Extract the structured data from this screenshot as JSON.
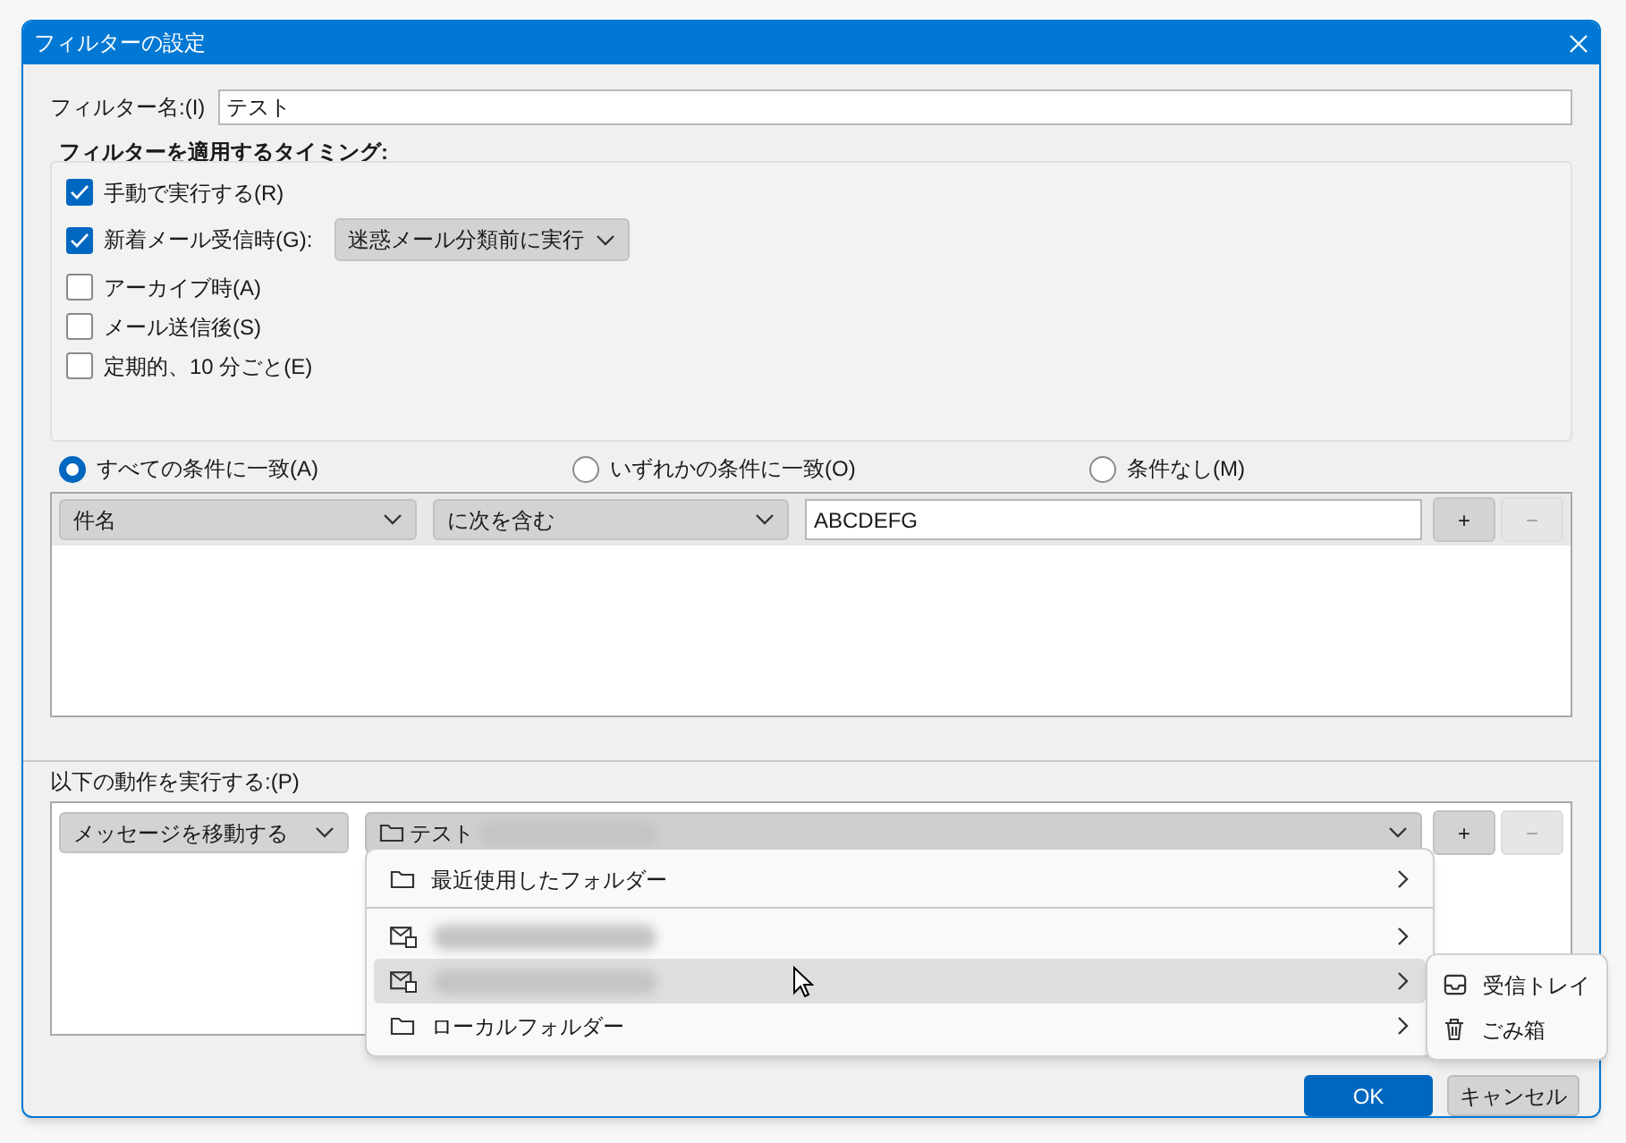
{
  "window": {
    "title": "フィルターの設定"
  },
  "filter_name": {
    "label": "フィルター名:(I)",
    "value": "テスト"
  },
  "timing": {
    "title": "フィルターを適用するタイミング:",
    "options": [
      {
        "label": "手動で実行する(R)",
        "checked": true
      },
      {
        "label": "新着メール受信時(G):",
        "checked": true,
        "dropdown": "迷惑メール分類前に実行"
      },
      {
        "label": "アーカイブ時(A)",
        "checked": false
      },
      {
        "label": "メール送信後(S)",
        "checked": false
      },
      {
        "label": "定期的、10 分ごと(E)",
        "checked": false
      }
    ]
  },
  "match": [
    {
      "label": "すべての条件に一致(A)",
      "selected": true
    },
    {
      "label": "いずれかの条件に一致(O)",
      "selected": false
    },
    {
      "label": "条件なし(M)",
      "selected": false
    }
  ],
  "conditions": [
    {
      "field": "件名",
      "operator": "に次を含む",
      "value": "ABCDEFG",
      "add": "+",
      "remove": "−",
      "remove_disabled": true
    }
  ],
  "actions_label": "以下の動作を実行する:(P)",
  "actions": [
    {
      "action": "メッセージを移動する",
      "folder": "テスト",
      "add": "+",
      "remove": "−",
      "remove_disabled": true
    }
  ],
  "folder_menu": {
    "items": [
      {
        "kind": "folder",
        "label": "最近使用したフォルダー",
        "selected": false
      },
      {
        "kind": "separator"
      },
      {
        "kind": "account",
        "selected": false
      },
      {
        "kind": "account",
        "selected": true
      },
      {
        "kind": "folder",
        "label": "ローカルフォルダー",
        "selected": false
      }
    ]
  },
  "submenu": {
    "items": [
      {
        "kind": "inbox",
        "label": "受信トレイ"
      },
      {
        "kind": "trash",
        "label": "ごみ箱"
      }
    ]
  },
  "buttons": [
    {
      "label": "OK",
      "primary": true
    },
    {
      "label": "キャンセル",
      "primary": false
    }
  ]
}
